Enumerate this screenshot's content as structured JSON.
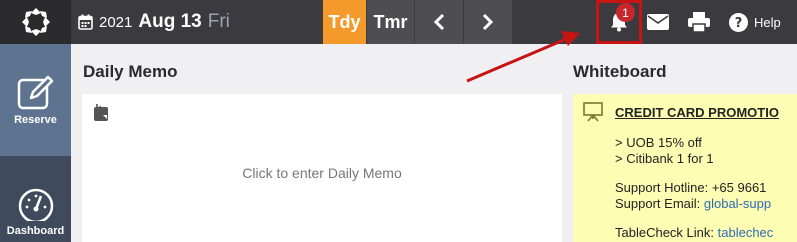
{
  "header": {
    "date": {
      "year": "2021",
      "month_day": "Aug 13",
      "weekday": "Fri"
    },
    "today_label": "Tdy",
    "tomorrow_label": "Tmr",
    "notifications_count": "1",
    "help_label": "Help"
  },
  "sidebar": {
    "items": [
      {
        "label": "Reserve",
        "icon": "edit-icon"
      },
      {
        "label": "Dashboard",
        "icon": "gauge-icon"
      }
    ]
  },
  "daily_memo": {
    "heading": "Daily Memo",
    "placeholder": "Click to enter Daily Memo"
  },
  "whiteboard": {
    "heading": "Whiteboard",
    "title": "CREDIT CARD PROMOTIO",
    "lines": [
      "> UOB 15% off",
      "> Citibank 1 for 1"
    ],
    "hotline_label": "Support Hotline: +65 9661",
    "email_label": "Support Email: ",
    "email_value": "global-supp",
    "link_label": "TableCheck Link: ",
    "link_value": "tablechec"
  },
  "colors": {
    "topbar": "#3b3b3f",
    "accent_today": "#f39a2a",
    "sidebar": "#3f4a5c",
    "sidebar_active": "#5e7390",
    "whiteboard_bg": "#fdfdb3",
    "annotation": "#c81313"
  }
}
